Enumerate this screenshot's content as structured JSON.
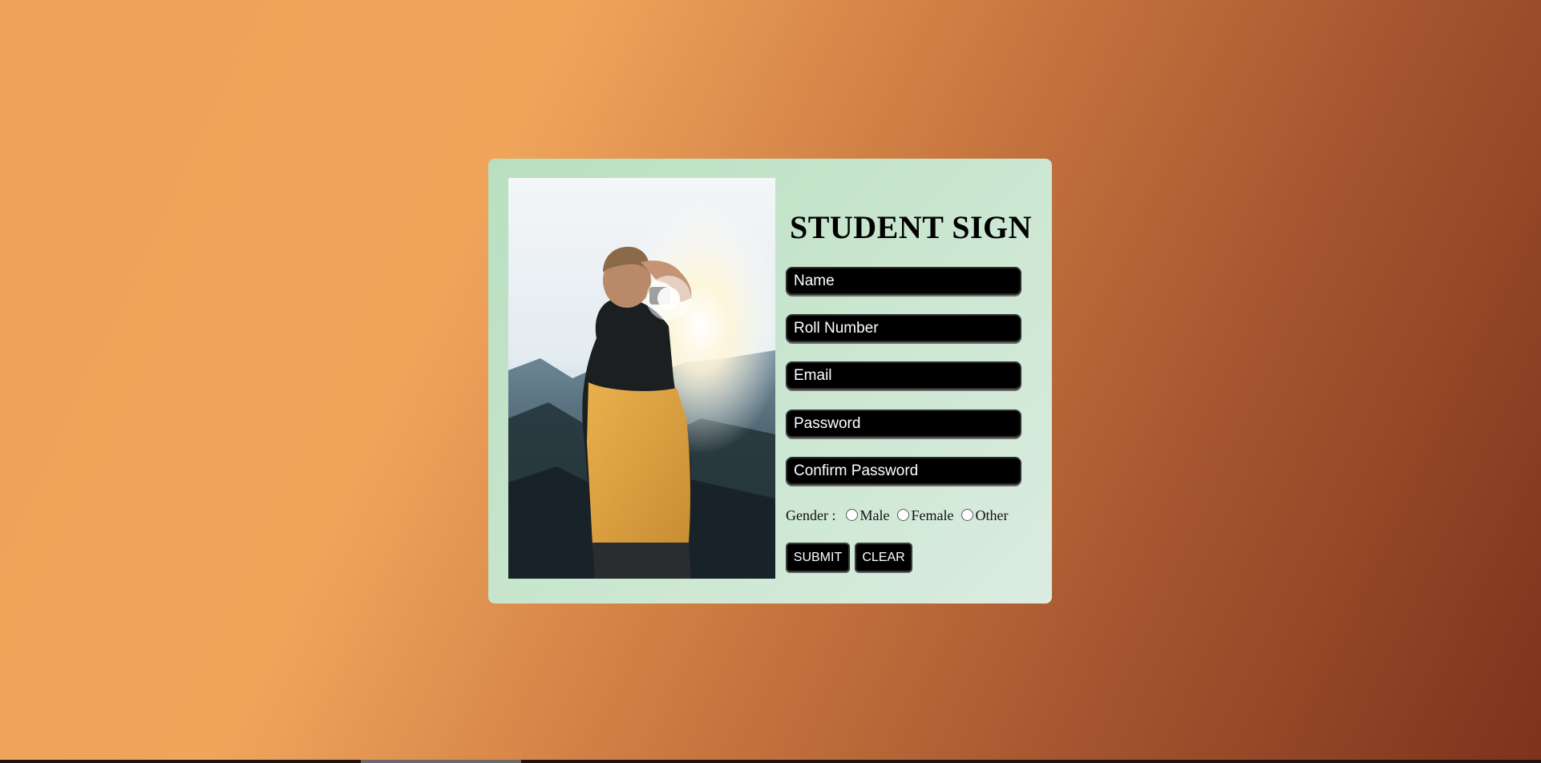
{
  "form": {
    "title": "STUDENT SIGN",
    "fields": {
      "name": "Name",
      "roll": "Roll Number",
      "email": "Email",
      "password": "Password",
      "confirm": "Confirm Password"
    },
    "gender": {
      "label": "Gender :",
      "options": [
        "Male",
        "Female",
        "Other"
      ]
    },
    "buttons": {
      "submit": "SUBMIT",
      "clear": "CLEAR"
    }
  },
  "photo": {
    "icon": "photographer-image"
  },
  "colors": {
    "card_bg": "#c9e6cf",
    "field_bg": "#000000",
    "field_text": "#ffffff",
    "bg_start": "#f0a55b",
    "bg_end": "#7e321c"
  }
}
